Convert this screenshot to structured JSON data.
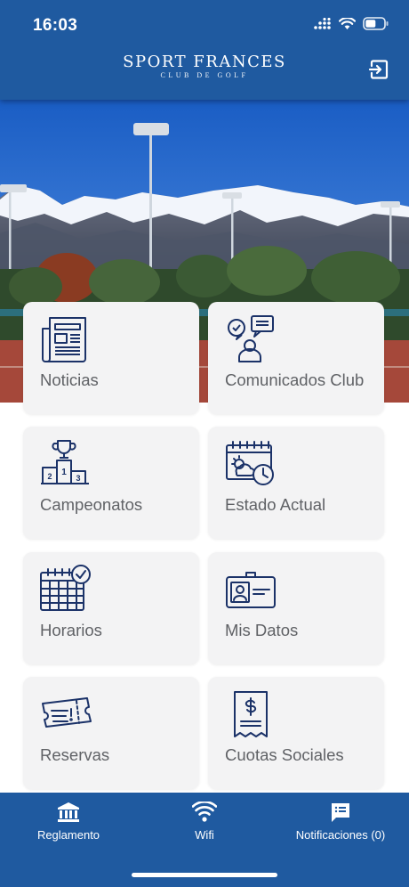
{
  "status_bar": {
    "time": "16:03",
    "icons": [
      "cellular-signal-icon",
      "wifi-icon",
      "battery-icon"
    ]
  },
  "header": {
    "brand_name": "SPORT FRANCES",
    "brand_sub": "CLUB DE GOLF",
    "logout_icon": "logout-icon",
    "background": "#1f5aa0"
  },
  "hero": {
    "image": "mountains-and-tennis-courts-photo"
  },
  "tiles": [
    {
      "label": "Noticias",
      "icon": "newspaper-icon"
    },
    {
      "label": "Comunicados Club",
      "icon": "speech-bubbles-icon"
    },
    {
      "label": "Campeonatos",
      "icon": "trophy-podium-icon"
    },
    {
      "label": "Estado Actual",
      "icon": "calendar-weather-icon"
    },
    {
      "label": "Horarios",
      "icon": "calendar-check-icon"
    },
    {
      "label": "Mis Datos",
      "icon": "id-card-icon"
    },
    {
      "label": "Reservas",
      "icon": "ticket-icon"
    },
    {
      "label": "Cuotas Sociales",
      "icon": "invoice-dollar-icon"
    }
  ],
  "bottom_nav": [
    {
      "label": "Reglamento",
      "icon": "institution-icon"
    },
    {
      "label": "Wifi",
      "icon": "wifi-icon"
    },
    {
      "label": "Notificaciones (0)",
      "icon": "message-list-icon"
    }
  ],
  "colors": {
    "primary": "#1f5aa0",
    "icon_navy": "#1b3268",
    "tile_bg": "#f3f3f4",
    "label_gray": "#606266"
  }
}
